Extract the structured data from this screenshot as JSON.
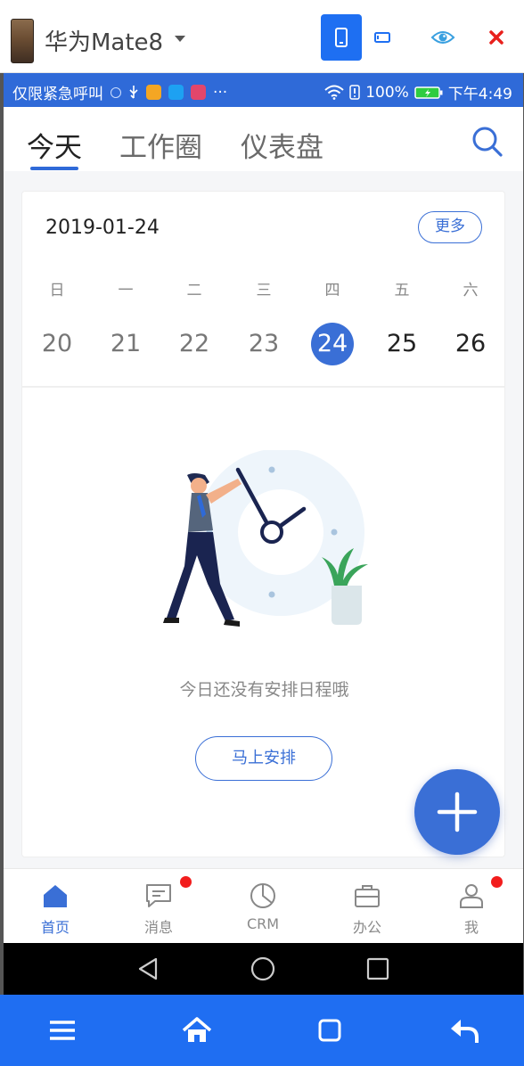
{
  "device": {
    "name": "华为Mate8",
    "controls": [
      "phone-view-icon",
      "tablet-view-icon",
      "eye-icon",
      "close-icon"
    ]
  },
  "statusbar": {
    "left_text": "仅限紧急呼叫",
    "battery": "100%",
    "time": "下午4:49"
  },
  "header": {
    "tabs": [
      {
        "label": "今天",
        "active": true
      },
      {
        "label": "工作圈",
        "active": false
      },
      {
        "label": "仪表盘",
        "active": false
      }
    ]
  },
  "calendar": {
    "date": "2019-01-24",
    "more_label": "更多",
    "weekdays": [
      "日",
      "一",
      "二",
      "三",
      "四",
      "五",
      "六"
    ],
    "days": [
      "20",
      "21",
      "22",
      "23",
      "24",
      "25",
      "26"
    ],
    "selected_index": 4
  },
  "empty_state": {
    "message": "今日还没有安排日程哦",
    "button_label": "马上安排"
  },
  "fab": {
    "icon": "plus-icon"
  },
  "bottom_nav": [
    {
      "label": "首页",
      "icon": "home-icon",
      "active": true,
      "badge": false
    },
    {
      "label": "消息",
      "icon": "message-icon",
      "active": false,
      "badge": true
    },
    {
      "label": "CRM",
      "icon": "pie-chart-icon",
      "active": false,
      "badge": false
    },
    {
      "label": "办公",
      "icon": "briefcase-icon",
      "active": false,
      "badge": false
    },
    {
      "label": "我",
      "icon": "user-icon",
      "active": false,
      "badge": true
    }
  ],
  "colors": {
    "accent": "#3a6fd6",
    "statusbar": "#2f6ad8",
    "toolbar": "#1f6ef2",
    "badge": "#f21d1d"
  }
}
